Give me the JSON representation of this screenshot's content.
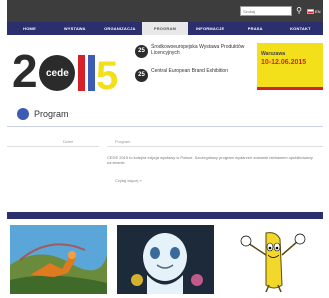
{
  "header": {
    "search_placeholder": "Szukaj",
    "search_icon": "search-icon",
    "language": "EN"
  },
  "nav": {
    "items": [
      {
        "label": "HOME",
        "active": false
      },
      {
        "label": "WYSTAWA",
        "active": false
      },
      {
        "label": "ORGANIZACJA",
        "active": false
      },
      {
        "label": "PROGRAM",
        "active": true
      },
      {
        "label": "INFORMACJE",
        "active": false
      },
      {
        "label": "PRASA",
        "active": false
      },
      {
        "label": "KONTAKT",
        "active": false
      }
    ]
  },
  "banner": {
    "year_text": "2015",
    "logo_text": "cede",
    "badge_number": "25",
    "expo1": "Środkowoeuropejska Wystawa Produktów Licencyjnych",
    "expo2": "Central European Brand Exhibition",
    "dates_label": "Warszawa",
    "dates_value": "10-12.06.2015",
    "colors": {
      "yellow": "#f3e01a",
      "red": "#d6202a",
      "navy": "#2c2f6e",
      "blue": "#3b5bb5"
    }
  },
  "page": {
    "title": "Program"
  },
  "content": {
    "label_left": "Dzień",
    "label_right": "Program",
    "paragraph": "CEDE 2015 to kolejna edycja wystawy w Polsce. Szczegółowy program wydarzeń zostanie niebawem opublikowany na stronie.",
    "more_link": "Czytaj więcej »"
  },
  "tiles": [
    {
      "icon": "dragon-landscape-image"
    },
    {
      "icon": "ghost-character-image"
    },
    {
      "icon": "banana-character-image"
    }
  ]
}
